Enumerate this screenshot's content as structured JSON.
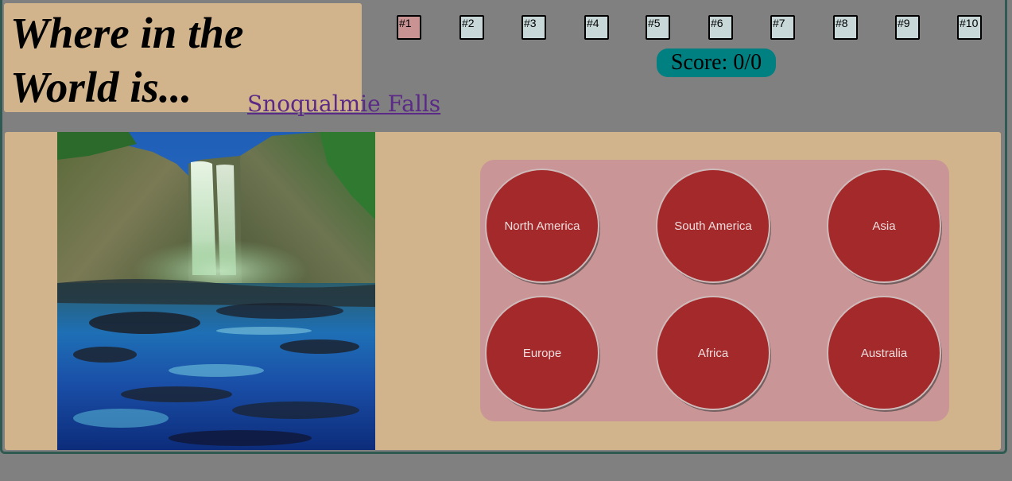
{
  "header": {
    "title": "Where in the World is...",
    "place_name": "Snoqualmie Falls"
  },
  "question_nav": {
    "items": [
      "#1",
      "#2",
      "#3",
      "#4",
      "#5",
      "#6",
      "#7",
      "#8",
      "#9",
      "#10"
    ],
    "active_index": 0,
    "active_color": "#c99393",
    "inactive_color": "#c8d8d8"
  },
  "score": {
    "label": "Score: 0/0"
  },
  "photo": {
    "icon": "waterfall-photo"
  },
  "answers": {
    "options": [
      "North America",
      "South America",
      "Asia",
      "Europe",
      "Africa",
      "Australia"
    ],
    "button_color": "#a3292a",
    "panel_color": "#c99596"
  },
  "colors": {
    "background": "#808080",
    "panel": "#d2b48c",
    "score_badge": "#008080",
    "link": "#5b2a86"
  }
}
